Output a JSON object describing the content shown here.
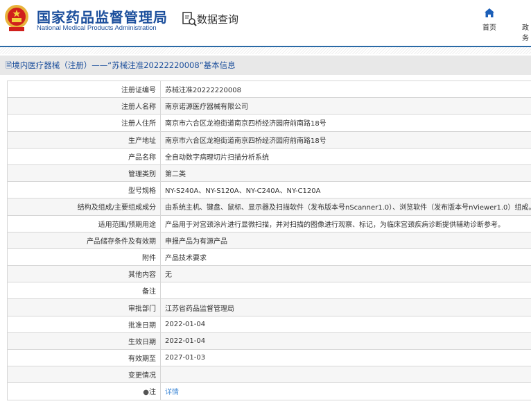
{
  "header": {
    "title_cn": "国家药品监督管理局",
    "title_en": "National Medical Products Administration",
    "query": "数据查询",
    "nav": [
      "首页",
      "政务"
    ]
  },
  "breadcrumb": "境内医疗器械（注册）——“苏械注准20222220008”基本信息",
  "rows": [
    {
      "label": "注册证编号",
      "value": "苏械注准20222220008"
    },
    {
      "label": "注册人名称",
      "value": "南京诺源医疗器械有限公司"
    },
    {
      "label": "注册人住所",
      "value": "南京市六合区龙袍街道南京四桥经济园府前南路18号"
    },
    {
      "label": "生产地址",
      "value": "南京市六合区龙袍街道南京四桥经济园府前南路18号"
    },
    {
      "label": "产品名称",
      "value": "全自动数字病理切片扫描分析系统"
    },
    {
      "label": "管理类别",
      "value": "第二类"
    },
    {
      "label": "型号规格",
      "value": "NY-S240A、NY-S120A、NY-C240A、NY-C120A"
    },
    {
      "label": "结构及组成/主要组成成分",
      "value": "由系统主机、键盘、鼠标、显示器及扫描软件（发布版本号nScanner1.0）、浏览软件（发布版本号nViewer1.0）组成。"
    },
    {
      "label": "适用范围/预期用途",
      "value": "产品用于对宫颈涂片进行显微扫描，并对扫描的图像进行观察、标记，为临床宫颈疾病诊断提供辅助诊断参考。"
    },
    {
      "label": "产品储存条件及有效期",
      "value": "申报产品为有源产品"
    },
    {
      "label": "附件",
      "value": "产品技术要求"
    },
    {
      "label": "其他内容",
      "value": "无"
    },
    {
      "label": "备注",
      "value": ""
    },
    {
      "label": "审批部门",
      "value": "江苏省药品监督管理局"
    },
    {
      "label": "批准日期",
      "value": "2022-01-04"
    },
    {
      "label": "生效日期",
      "value": "2022-01-04"
    },
    {
      "label": "有效期至",
      "value": "2027-01-03"
    },
    {
      "label": "变更情况",
      "value": ""
    }
  ],
  "note": {
    "label": "注",
    "link": "详情"
  },
  "colors": {
    "brand": "#1c4f9c",
    "link": "#4a8fd8"
  }
}
